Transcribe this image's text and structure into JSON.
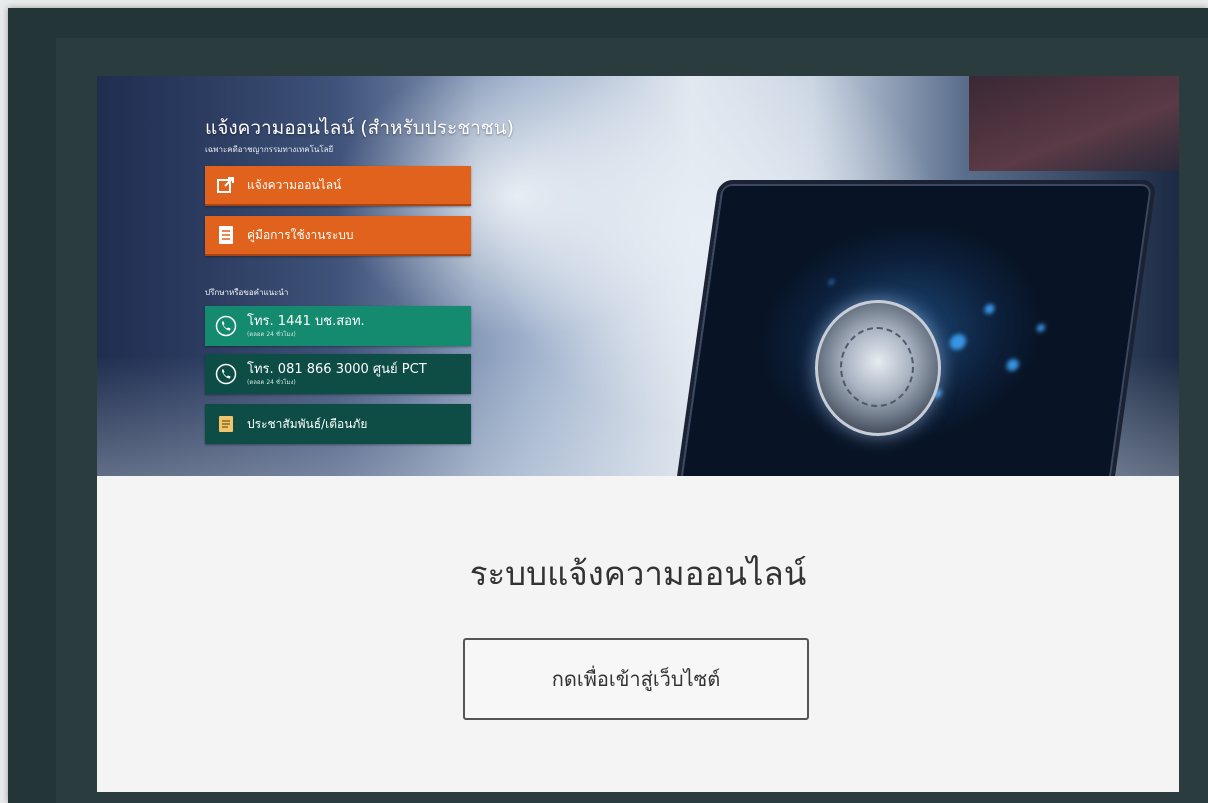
{
  "banner": {
    "title": "แจ้งความออนไลน์ (สำหรับประชาชน)",
    "subtitle": "เฉพาะคดีอาชญากรรมทางเทคโนโลยี",
    "buttons": {
      "report_online": "แจ้งความออนไลน์",
      "manual": "คู่มือการใช้งานระบบ"
    },
    "consult_label": "ปรึกษาหรือขอคำแนะนำ",
    "hotline_1441": {
      "label": "โทร. 1441 บช.สอท.",
      "note": "(ตลอด 24 ชั่วโมง)"
    },
    "hotline_pct": {
      "label": "โทร. 081 866 3000 ศูนย์ PCT",
      "note": "(ตลอด 24 ชั่วโมง)"
    },
    "news_warning": "ประชาสัมพันธ์/เตือนภัย",
    "accent_orange": "#e1621c",
    "accent_green": "#148a6e",
    "accent_dark_green": "#0d4d46"
  },
  "main": {
    "title": "ระบบแจ้งความออนไลน์",
    "enter_button": "กดเพื่อเข้าสู่เว็บไซต์"
  },
  "icons": {
    "external_link": "external-link-icon",
    "document": "document-icon",
    "phone": "phone-icon",
    "news": "news-icon"
  }
}
